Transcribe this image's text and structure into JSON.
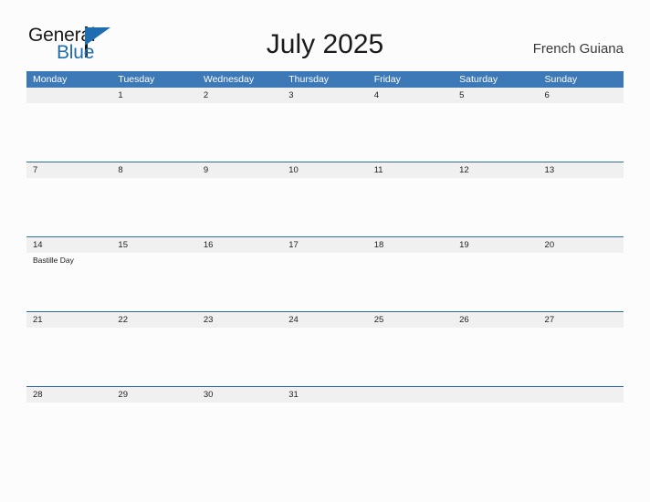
{
  "brand": {
    "name_part1": "General",
    "name_part2": "Blue",
    "accent_color": "#1f6cb0",
    "triangle_icon": "triangle-icon"
  },
  "header": {
    "title": "July 2025",
    "location": "French Guiana"
  },
  "calendar": {
    "header_bg_color": "#3c79b6",
    "row_border_color": "#2e6da4",
    "date_strip_color": "#f0f0f0",
    "weekdays": [
      "Monday",
      "Tuesday",
      "Wednesday",
      "Thursday",
      "Friday",
      "Saturday",
      "Sunday"
    ],
    "weeks": [
      {
        "days": [
          {
            "date": "",
            "events": []
          },
          {
            "date": "1",
            "events": []
          },
          {
            "date": "2",
            "events": []
          },
          {
            "date": "3",
            "events": []
          },
          {
            "date": "4",
            "events": []
          },
          {
            "date": "5",
            "events": []
          },
          {
            "date": "6",
            "events": []
          }
        ]
      },
      {
        "days": [
          {
            "date": "7",
            "events": []
          },
          {
            "date": "8",
            "events": []
          },
          {
            "date": "9",
            "events": []
          },
          {
            "date": "10",
            "events": []
          },
          {
            "date": "11",
            "events": []
          },
          {
            "date": "12",
            "events": []
          },
          {
            "date": "13",
            "events": []
          }
        ]
      },
      {
        "days": [
          {
            "date": "14",
            "events": [
              "Bastille Day"
            ]
          },
          {
            "date": "15",
            "events": []
          },
          {
            "date": "16",
            "events": []
          },
          {
            "date": "17",
            "events": []
          },
          {
            "date": "18",
            "events": []
          },
          {
            "date": "19",
            "events": []
          },
          {
            "date": "20",
            "events": []
          }
        ]
      },
      {
        "days": [
          {
            "date": "21",
            "events": []
          },
          {
            "date": "22",
            "events": []
          },
          {
            "date": "23",
            "events": []
          },
          {
            "date": "24",
            "events": []
          },
          {
            "date": "25",
            "events": []
          },
          {
            "date": "26",
            "events": []
          },
          {
            "date": "27",
            "events": []
          }
        ]
      },
      {
        "days": [
          {
            "date": "28",
            "events": []
          },
          {
            "date": "29",
            "events": []
          },
          {
            "date": "30",
            "events": []
          },
          {
            "date": "31",
            "events": []
          },
          {
            "date": "",
            "events": []
          },
          {
            "date": "",
            "events": []
          },
          {
            "date": "",
            "events": []
          }
        ]
      }
    ]
  }
}
